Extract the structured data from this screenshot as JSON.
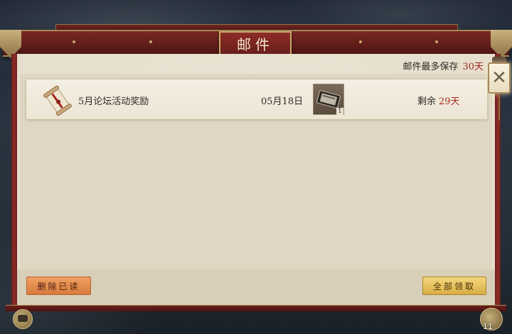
{
  "window": {
    "title": "邮件"
  },
  "header": {
    "retention_label": "邮件最多保存",
    "retention_days": "30天"
  },
  "mail_list": [
    {
      "title": "5月论坛活动奖励",
      "date": "05月18日",
      "item_quantity": "1",
      "remaining_label": "剩余",
      "remaining_days": "29天",
      "icon": "scroll-icon"
    }
  ],
  "footer": {
    "delete_read_label": "删除已读",
    "claim_all_label": "全部领取"
  },
  "corner": {
    "menu_badge": "11"
  },
  "colors": {
    "accent_red": "#a32821",
    "beam": "#6a1f1b",
    "panel": "#e6dfcd",
    "claim_gold": "#d9ae44",
    "delete_orange": "#d87a3e"
  }
}
